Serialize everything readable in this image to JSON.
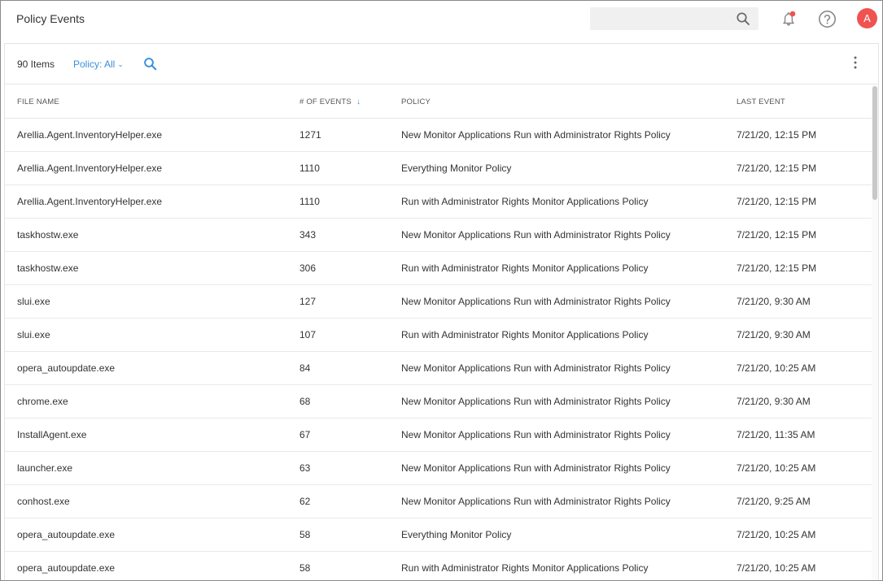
{
  "header": {
    "title": "Policy Events",
    "search_placeholder": "",
    "avatar_initial": "A",
    "accent": "#3a8fdc",
    "avatar_color": "#ef5350",
    "notification_dot": "#ef5350"
  },
  "toolbar": {
    "item_count": "90 Items",
    "filter_label": "Policy: All"
  },
  "table": {
    "columns": [
      {
        "label": "FILE NAME"
      },
      {
        "label": "# OF EVENTS",
        "sorted": "desc"
      },
      {
        "label": "POLICY"
      },
      {
        "label": "LAST EVENT"
      }
    ],
    "rows": [
      {
        "file": "Arellia.Agent.InventoryHelper.exe",
        "events": "1271",
        "policy": "New Monitor Applications Run with Administrator Rights Policy",
        "last": "7/21/20, 12:15 PM"
      },
      {
        "file": "Arellia.Agent.InventoryHelper.exe",
        "events": "1110",
        "policy": "Everything Monitor Policy",
        "last": "7/21/20, 12:15 PM"
      },
      {
        "file": "Arellia.Agent.InventoryHelper.exe",
        "events": "1110",
        "policy": "Run with Administrator Rights Monitor Applications Policy",
        "last": "7/21/20, 12:15 PM"
      },
      {
        "file": "taskhostw.exe",
        "events": "343",
        "policy": "New Monitor Applications Run with Administrator Rights Policy",
        "last": "7/21/20, 12:15 PM"
      },
      {
        "file": "taskhostw.exe",
        "events": "306",
        "policy": "Run with Administrator Rights Monitor Applications Policy",
        "last": "7/21/20, 12:15 PM"
      },
      {
        "file": "slui.exe",
        "events": "127",
        "policy": "New Monitor Applications Run with Administrator Rights Policy",
        "last": "7/21/20, 9:30 AM"
      },
      {
        "file": "slui.exe",
        "events": "107",
        "policy": "Run with Administrator Rights Monitor Applications Policy",
        "last": "7/21/20, 9:30 AM"
      },
      {
        "file": "opera_autoupdate.exe",
        "events": "84",
        "policy": "New Monitor Applications Run with Administrator Rights Policy",
        "last": "7/21/20, 10:25 AM"
      },
      {
        "file": "chrome.exe",
        "events": "68",
        "policy": "New Monitor Applications Run with Administrator Rights Policy",
        "last": "7/21/20, 9:30 AM"
      },
      {
        "file": "InstallAgent.exe",
        "events": "67",
        "policy": "New Monitor Applications Run with Administrator Rights Policy",
        "last": "7/21/20, 11:35 AM"
      },
      {
        "file": "launcher.exe",
        "events": "63",
        "policy": "New Monitor Applications Run with Administrator Rights Policy",
        "last": "7/21/20, 10:25 AM"
      },
      {
        "file": "conhost.exe",
        "events": "62",
        "policy": "New Monitor Applications Run with Administrator Rights Policy",
        "last": "7/21/20, 9:25 AM"
      },
      {
        "file": "opera_autoupdate.exe",
        "events": "58",
        "policy": "Everything Monitor Policy",
        "last": "7/21/20, 10:25 AM"
      },
      {
        "file": "opera_autoupdate.exe",
        "events": "58",
        "policy": "Run with Administrator Rights Monitor Applications Policy",
        "last": "7/21/20, 10:25 AM"
      }
    ]
  }
}
